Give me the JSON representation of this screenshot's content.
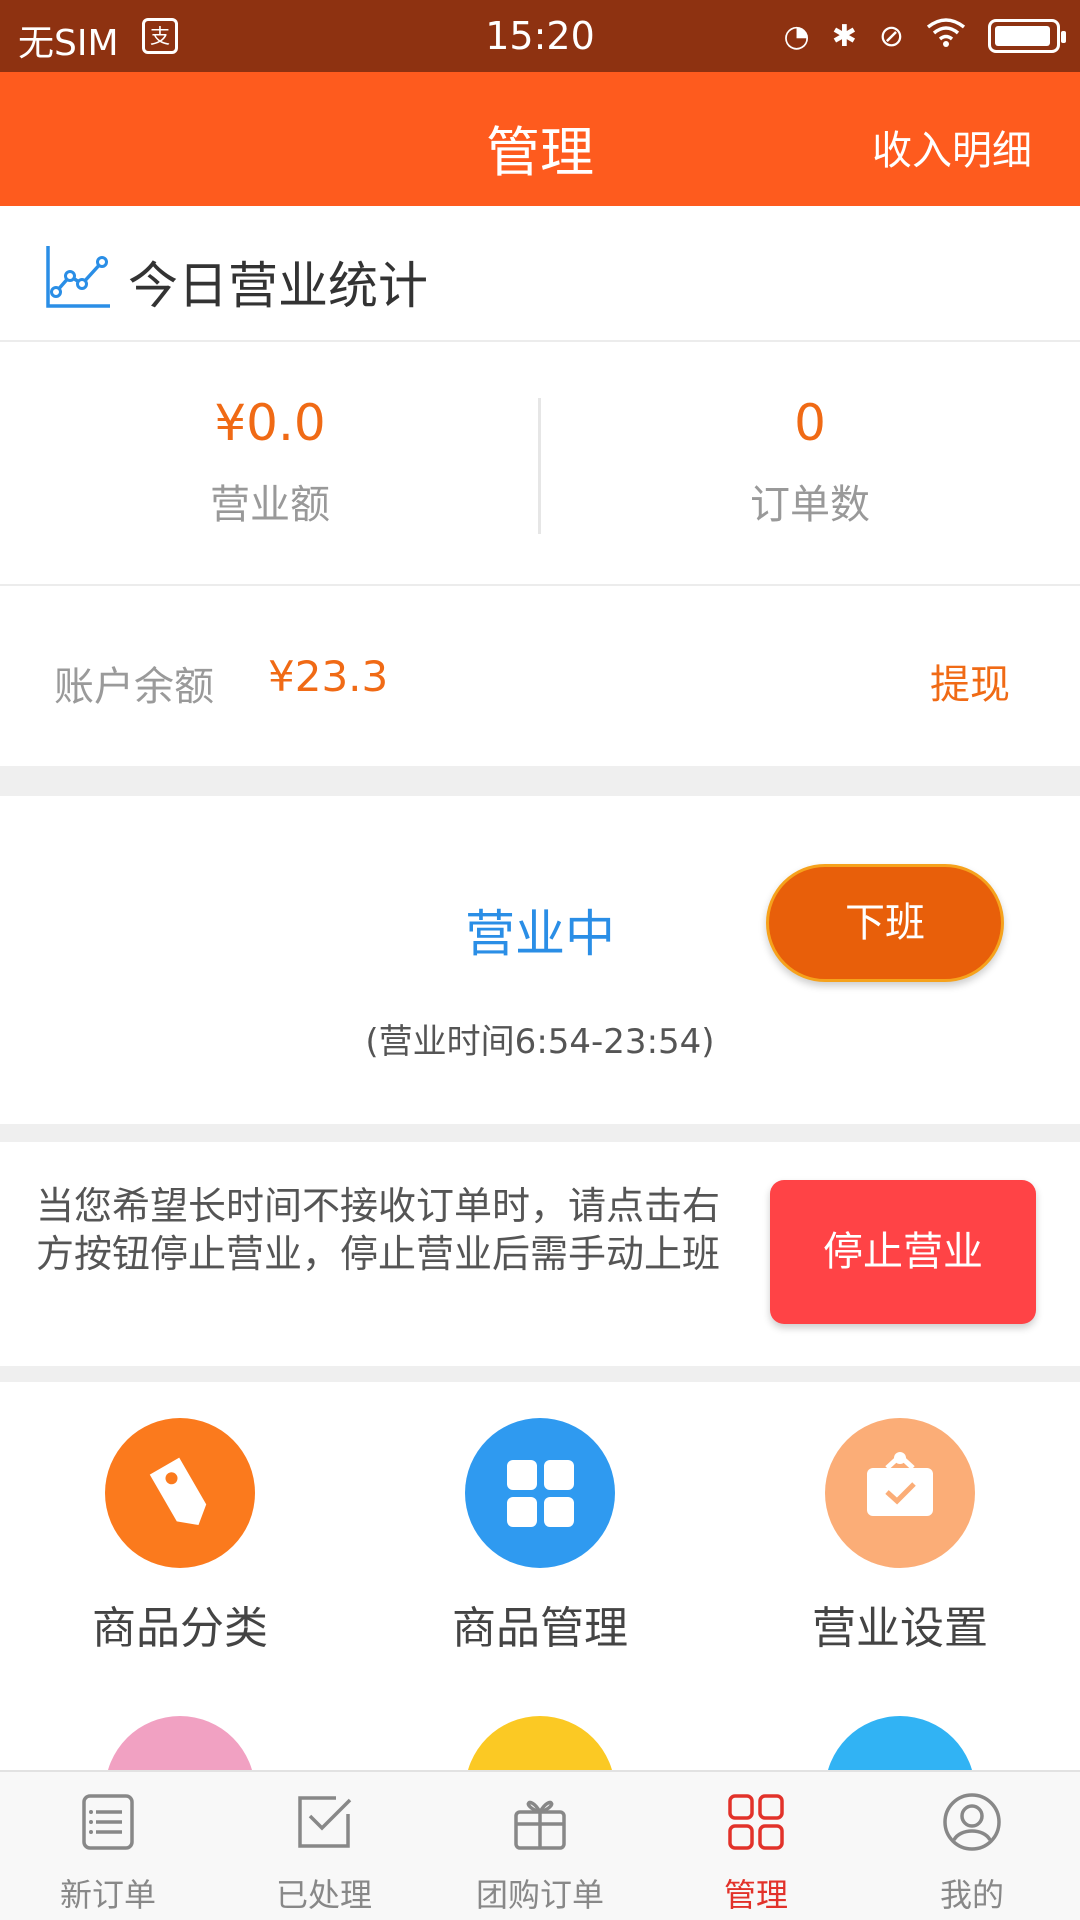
{
  "status_bar": {
    "carrier": "无SIM",
    "notification_icon": "message-icon",
    "time": "15:20",
    "icons": [
      "sync-icon",
      "bluetooth-icon",
      "mute-icon",
      "wifi-icon",
      "battery-icon"
    ],
    "battery_level": 0.95
  },
  "header": {
    "title": "管理",
    "income_detail": "收入明细",
    "color": "#fe5b1e"
  },
  "today_stats": {
    "title": "今日营业统计",
    "icon": "line-chart-icon",
    "revenue_value": "¥0.0",
    "revenue_label": "营业额",
    "orders_value": "0",
    "orders_label": "订单数"
  },
  "balance": {
    "label": "账户余额",
    "amount": "¥23.3",
    "withdraw": "提现"
  },
  "business": {
    "status": "营业中",
    "off_button": "下班",
    "hours": "(营业时间6:54-23:54)"
  },
  "stop": {
    "description": "当您希望长时间不接收订单时，请点击右方按钮停止营业，停止营业后需手动上班",
    "button": "停止营业"
  },
  "grid": {
    "items": [
      {
        "label": "商品分类",
        "icon": "tag-icon",
        "color": "#fb7a1d"
      },
      {
        "label": "商品管理",
        "icon": "grid-icon",
        "color": "#2f9af0"
      },
      {
        "label": "营业设置",
        "icon": "shop-bag-icon",
        "color": "#fbad77"
      }
    ],
    "partial_row_colors": [
      "#f1a1c2",
      "#fbc924",
      "#31b3f4"
    ]
  },
  "bottom_nav": {
    "items": [
      {
        "label": "新订单",
        "icon": "order-list-icon"
      },
      {
        "label": "已处理",
        "icon": "processed-icon"
      },
      {
        "label": "团购订单",
        "icon": "gift-icon"
      },
      {
        "label": "管理",
        "icon": "manage-grid-icon"
      },
      {
        "label": "我的",
        "icon": "user-icon"
      }
    ],
    "active": "管理",
    "active_color": "#e2322a"
  }
}
